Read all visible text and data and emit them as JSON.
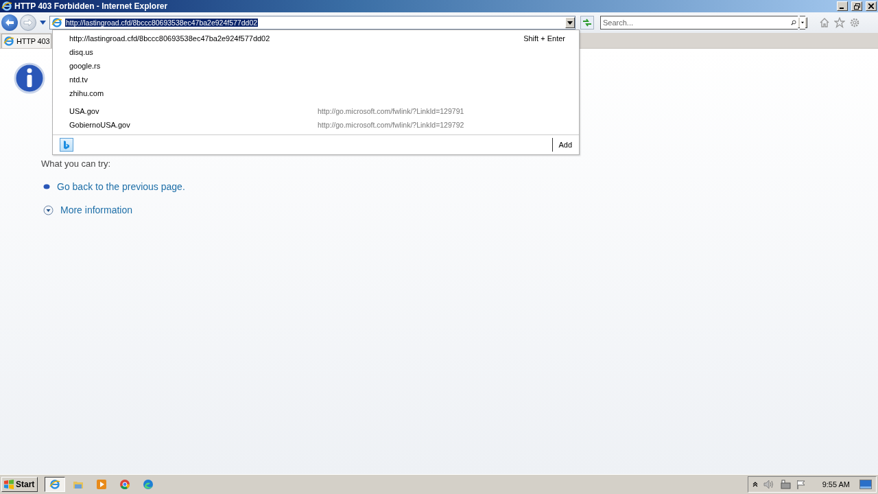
{
  "window": {
    "title": "HTTP 403 Forbidden - Internet Explorer"
  },
  "address_bar": {
    "value": "http://lastingroad.cfd/8bccc80693538ec47ba2e924f577dd02",
    "selected": true
  },
  "search": {
    "placeholder": "Search..."
  },
  "tabs": [
    {
      "label": "HTTP 403",
      "selected": true
    }
  ],
  "dropdown": {
    "items": [
      {
        "text": "http://lastingroad.cfd/8bccc80693538ec47ba2e924f577dd02",
        "hint": "Shift + Enter"
      },
      {
        "text": "disq.us"
      },
      {
        "text": "google.rs"
      },
      {
        "text": "ntd.tv"
      },
      {
        "text": "zhihu.com"
      }
    ],
    "favorites": [
      {
        "text": "USA.gov",
        "url": "http://go.microsoft.com/fwlink/?LinkId=129791"
      },
      {
        "text": "GobiernoUSA.gov",
        "url": "http://go.microsoft.com/fwlink/?LinkId=129792"
      }
    ],
    "add_label": "Add"
  },
  "page": {
    "subtitle": "What you can try:",
    "actions": [
      {
        "kind": "bullet",
        "text": "Go back to the previous page."
      },
      {
        "kind": "expander",
        "text": "More information"
      }
    ]
  },
  "taskbar": {
    "start": "Start",
    "apps": [
      {
        "kind": "ie",
        "selected": true
      },
      {
        "kind": "folder",
        "selected": false
      },
      {
        "kind": "media",
        "selected": false
      },
      {
        "kind": "chrome",
        "selected": false
      },
      {
        "kind": "edge",
        "selected": false
      }
    ],
    "clock": "9:55 AM"
  }
}
